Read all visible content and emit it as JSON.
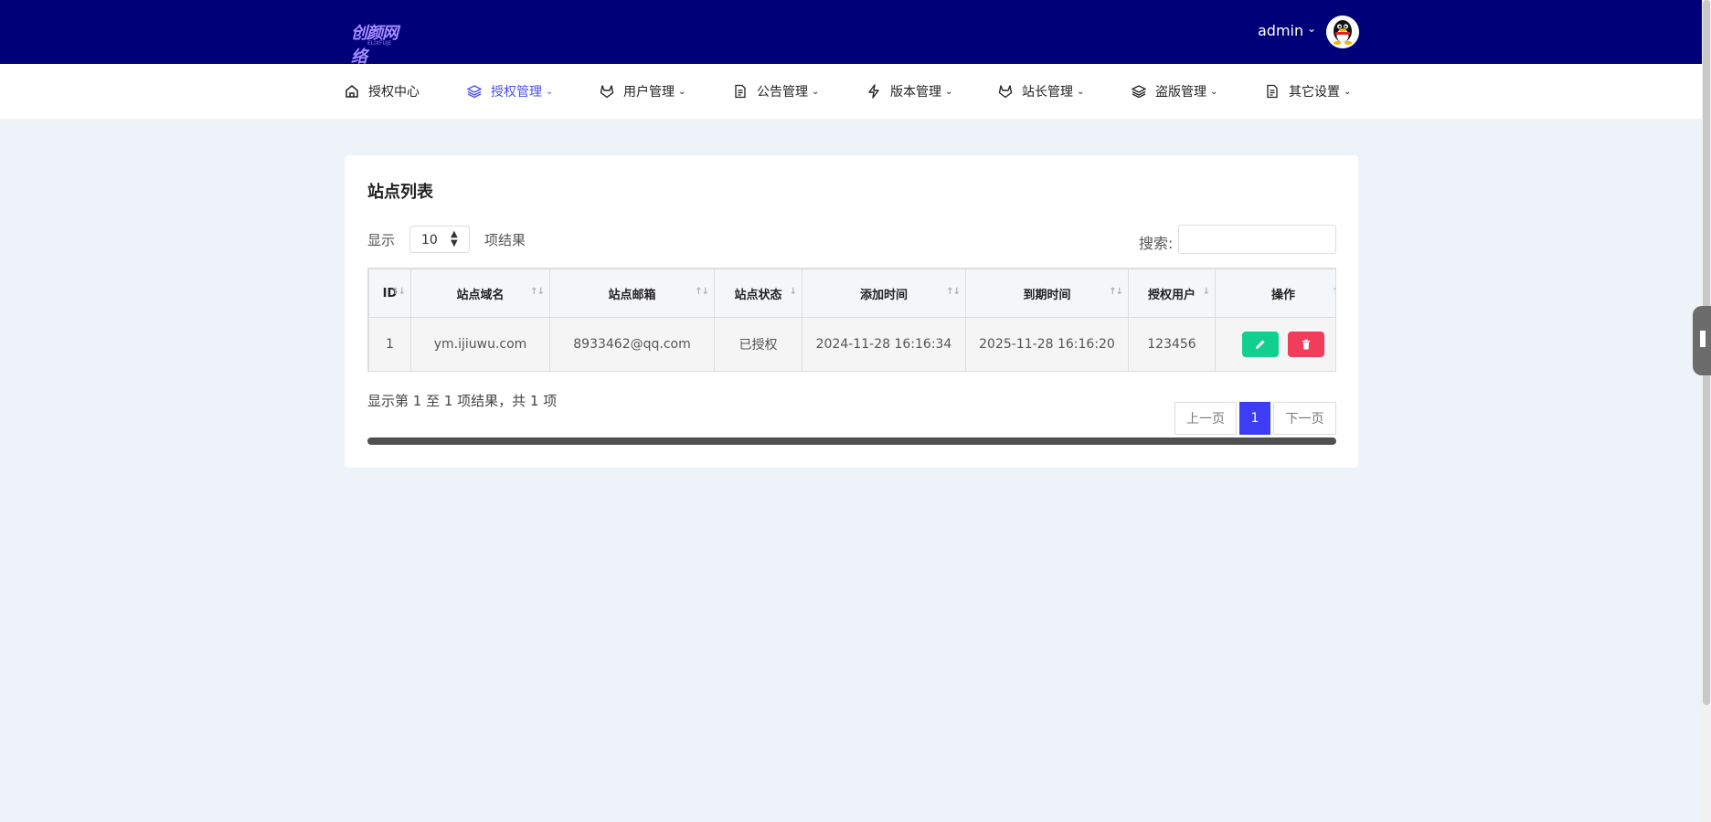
{
  "header": {
    "logo_text": "创颜网络",
    "logo_sub": "ELIXFUJE",
    "username": "admin"
  },
  "nav": [
    {
      "label": "授权中心",
      "icon": "home-icon",
      "has_caret": false,
      "active": false
    },
    {
      "label": "授权管理",
      "icon": "layers-icon",
      "has_caret": true,
      "active": true
    },
    {
      "label": "用户管理",
      "icon": "gitlab-icon",
      "has_caret": true,
      "active": false
    },
    {
      "label": "公告管理",
      "icon": "file-text-icon",
      "has_caret": true,
      "active": false
    },
    {
      "label": "版本管理",
      "icon": "lightning-icon",
      "has_caret": true,
      "active": false
    },
    {
      "label": "站长管理",
      "icon": "gitlab-icon",
      "has_caret": true,
      "active": false
    },
    {
      "label": "盗版管理",
      "icon": "layers-icon",
      "has_caret": true,
      "active": false
    },
    {
      "label": "其它设置",
      "icon": "file-text-icon",
      "has_caret": true,
      "active": false
    }
  ],
  "card": {
    "title": "站点列表",
    "show_label": "显示",
    "page_size": "10",
    "results_label": "项结果",
    "search_label": "搜索:",
    "search_value": ""
  },
  "table": {
    "headers": [
      "ID",
      "站点域名",
      "站点邮箱",
      "站点状态",
      "添加时间",
      "到期时间",
      "授权用户",
      "操作"
    ],
    "rows": [
      {
        "id": "1",
        "domain": "ym.ijiuwu.com",
        "email": "8933462@qq.com",
        "status": "已授权",
        "added": "2024-11-28 16:16:34",
        "expires": "2025-11-28 16:16:20",
        "user": "123456"
      }
    ]
  },
  "footer": {
    "info": "显示第 1 至 1 项结果，共 1 项",
    "prev": "上一页",
    "page": "1",
    "next": "下一页"
  },
  "colors": {
    "topbar": "#000079",
    "accent": "#4a4ff0",
    "edit": "#13cf8f",
    "delete": "#f23c5c",
    "page_active": "#3d3df5"
  }
}
